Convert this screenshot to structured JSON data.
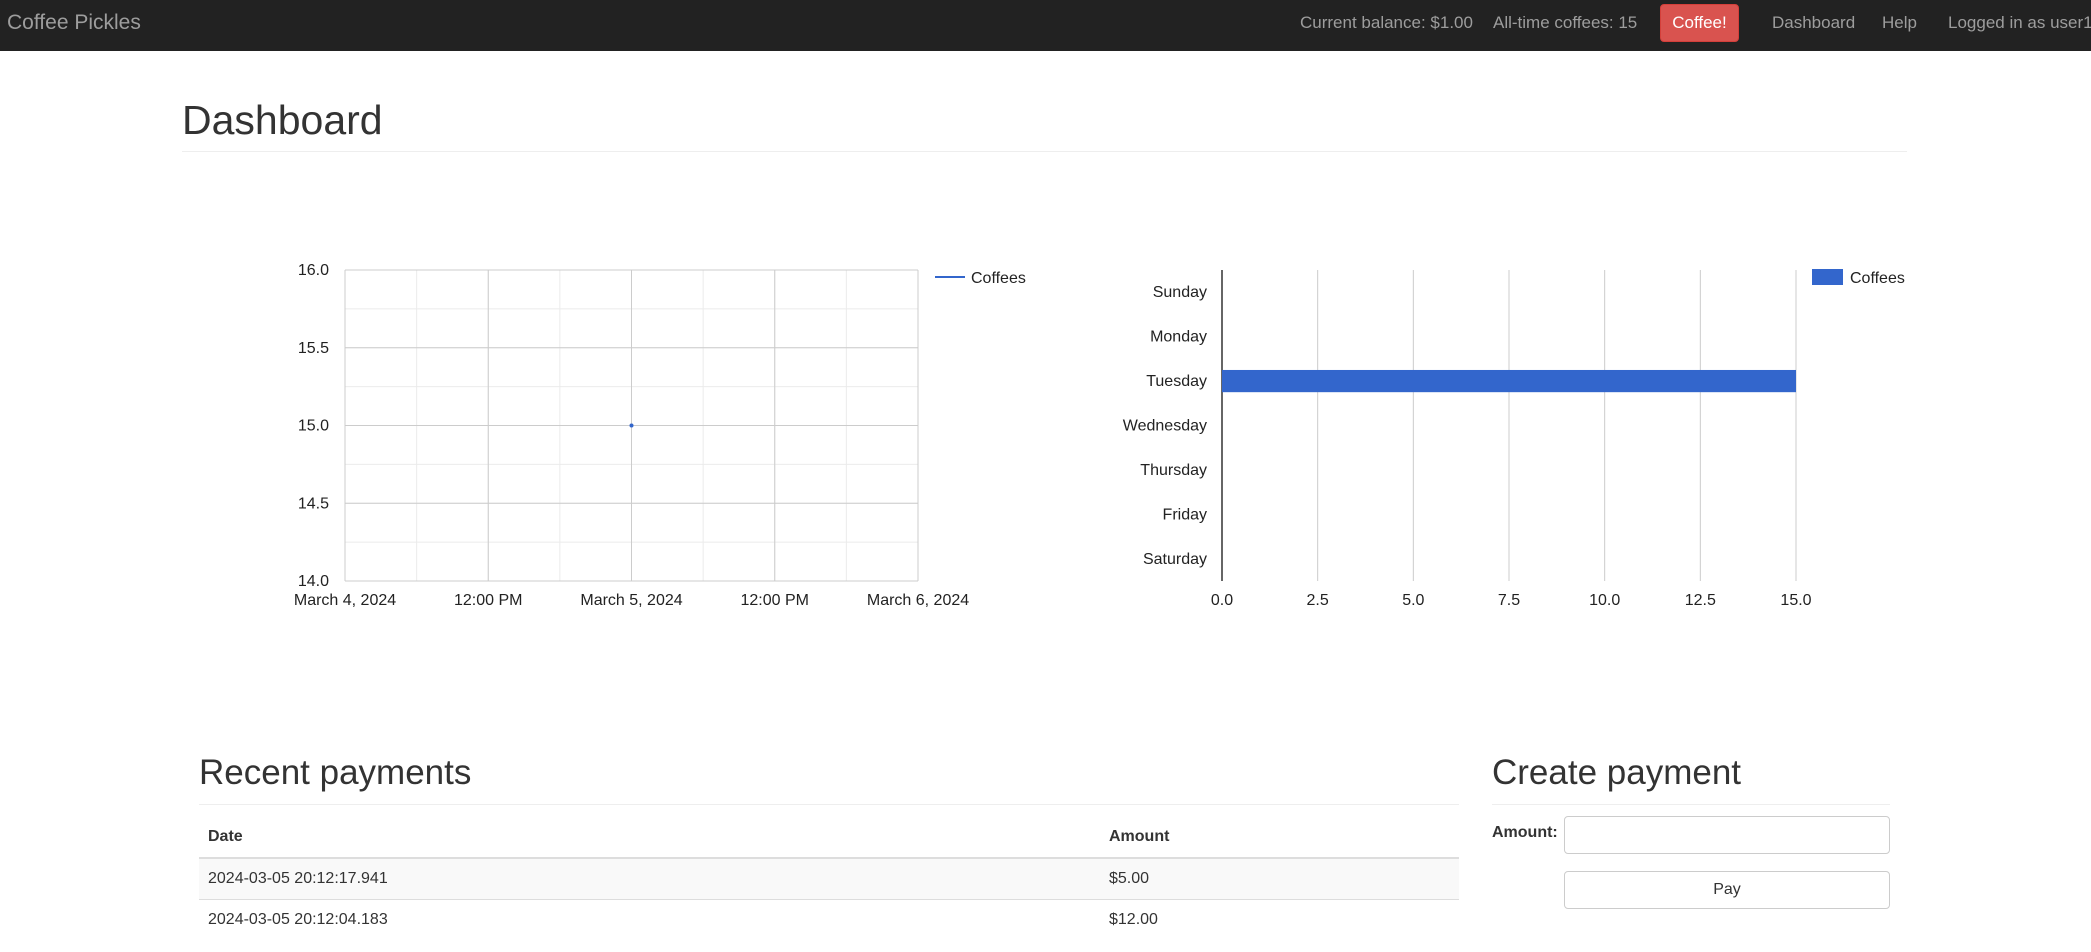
{
  "navbar": {
    "brand": "Coffee Pickles",
    "balance": "Current balance: $1.00",
    "alltime": "All-time coffees: 15",
    "coffee_button": "Coffee!",
    "dashboard_link": "Dashboard",
    "help_link": "Help",
    "user": "Logged in as user1"
  },
  "page": {
    "title": "Dashboard"
  },
  "colors": {
    "series": "#3366cc",
    "coffee_button": "#d9534f",
    "navbar": "#222222"
  },
  "chart_data": [
    {
      "type": "line",
      "legend": [
        "Coffees"
      ],
      "legend_position": "right",
      "x_ticks": [
        "March 4, 2024",
        "12:00 PM",
        "March 5, 2024",
        "12:00 PM",
        "March 6, 2024"
      ],
      "y_ticks": [
        "16.0",
        "15.5",
        "15.0",
        "14.5",
        "14.0"
      ],
      "ylim": [
        14.0,
        16.0
      ],
      "xlim": [
        "2024-03-04 00:00",
        "2024-03-06 00:00"
      ],
      "series": [
        {
          "name": "Coffees",
          "points": [
            {
              "x": "2024-03-05 00:00",
              "y": 15
            }
          ]
        }
      ],
      "grid": true
    },
    {
      "type": "bar",
      "orientation": "horizontal",
      "legend": [
        "Coffees"
      ],
      "legend_position": "top-right",
      "categories": [
        "Sunday",
        "Monday",
        "Tuesday",
        "Wednesday",
        "Thursday",
        "Friday",
        "Saturday"
      ],
      "values": [
        0,
        0,
        15,
        0,
        0,
        0,
        0
      ],
      "x_ticks": [
        "0.0",
        "2.5",
        "5.0",
        "7.5",
        "10.0",
        "12.5",
        "15.0"
      ],
      "xlim": [
        0,
        15
      ],
      "grid": true
    }
  ],
  "payments": {
    "title": "Recent payments",
    "columns": [
      "Date",
      "Amount"
    ],
    "rows": [
      [
        "2024-03-05 20:12:17.941",
        "$5.00"
      ],
      [
        "2024-03-05 20:12:04.183",
        "$12.00"
      ]
    ]
  },
  "create_payment": {
    "title": "Create payment",
    "amount_label": "Amount:",
    "amount_value": "",
    "pay_button": "Pay"
  }
}
